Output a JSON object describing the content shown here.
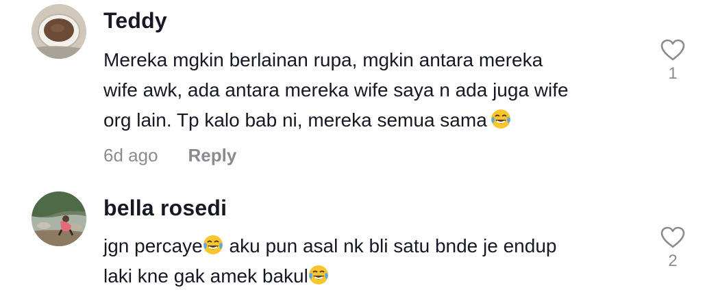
{
  "comments": [
    {
      "username": "Teddy",
      "lines": [
        "Mereka mgkin berlainan rupa, mgkin antara mereka",
        "wife awk, ada antara mereka wife saya n ada juga wife",
        "org lain. Tp kalo bab ni, mereka semua sama"
      ],
      "emoji": "face-with-tears-of-joy",
      "time": "6d ago",
      "reply_label": "Reply",
      "like_count": "1",
      "avatar": "coffee-cup-avatar"
    },
    {
      "username": "bella rosedi",
      "line1_before_emoji": "jgn percaye",
      "line1_after_emoji": " aku pun asal nk bli satu bnde je endup",
      "line2": "laki kne gak amek bakul",
      "emoji": "face-with-tears-of-joy",
      "like_count": "2",
      "avatar": "river-photo-avatar"
    }
  ],
  "colors": {
    "text": "#161823",
    "secondary": "#8a8b91",
    "background": "#ffffff"
  }
}
